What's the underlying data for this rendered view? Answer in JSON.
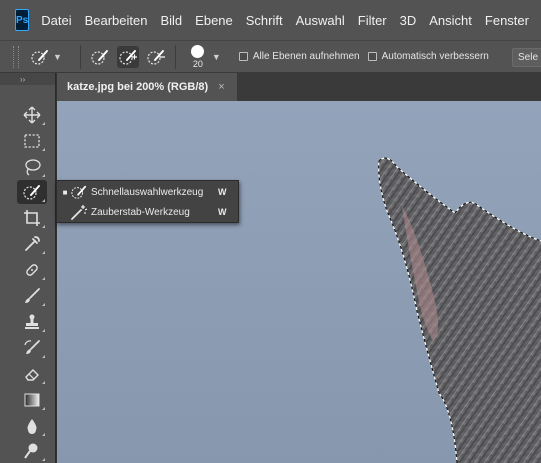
{
  "app": {
    "logo_text": "Ps"
  },
  "menu": [
    "Datei",
    "Bearbeiten",
    "Bild",
    "Ebene",
    "Schrift",
    "Auswahl",
    "Filter",
    "3D",
    "Ansicht",
    "Fenster"
  ],
  "options": {
    "brush_size": "20",
    "sample_all_layers_label": "Alle Ebenen aufnehmen",
    "auto_enhance_label": "Automatisch verbessern",
    "select_subject_label": "Sele"
  },
  "toolbar": {
    "collapse_glyph": "››",
    "tools": [
      "move-tool",
      "marquee-tool",
      "lasso-tool",
      "quick-selection-tool",
      "crop-tool",
      "eyedropper-tool",
      "healing-brush-tool",
      "brush-tool",
      "clone-stamp-tool",
      "history-brush-tool",
      "eraser-tool",
      "gradient-tool",
      "blur-tool",
      "dodge-tool"
    ]
  },
  "document": {
    "tab_title": "katze.jpg bei 200% (RGB/8)",
    "close_glyph": "×"
  },
  "flyout": {
    "items": [
      {
        "label": "Schnellauswahlwerkzeug",
        "shortcut": "W",
        "selected": true,
        "icon": "quick-selection-icon"
      },
      {
        "label": "Zauberstab-Werkzeug",
        "shortcut": "W",
        "selected": false,
        "icon": "magic-wand-icon"
      }
    ],
    "bullet": "■"
  },
  "colors": {
    "ui_panel": "#535353",
    "ui_dark": "#323232",
    "canvas_sky": "#8f9fb6",
    "accent_blue": "#31a8ff"
  }
}
